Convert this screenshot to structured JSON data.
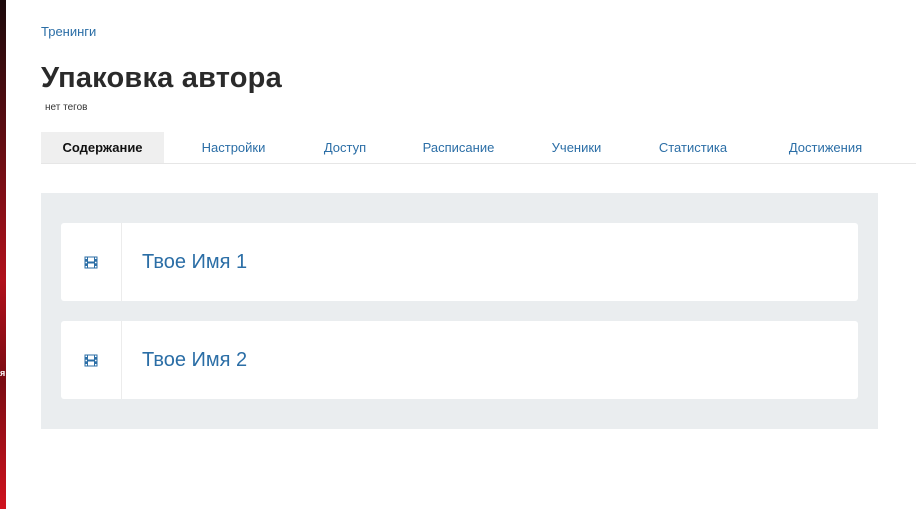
{
  "breadcrumb": {
    "label": "Тренинги"
  },
  "header": {
    "title": "Упаковка автора",
    "tags": "нет тегов"
  },
  "tabs": [
    {
      "label": "Содержание",
      "active": true
    },
    {
      "label": "Настройки",
      "active": false
    },
    {
      "label": "Доступ",
      "active": false
    },
    {
      "label": "Расписание",
      "active": false
    },
    {
      "label": "Ученики",
      "active": false
    },
    {
      "label": "Статистика",
      "active": false
    },
    {
      "label": "Достижения",
      "active": false
    }
  ],
  "lessons": [
    {
      "title": "Твое Имя 1",
      "icon": "film-icon"
    },
    {
      "title": "Твое Имя 2",
      "icon": "film-icon"
    }
  ],
  "sidebar_strip": {
    "letter": "я"
  },
  "colors": {
    "link": "#2b6ea6",
    "active_tab_bg": "#efefef",
    "panel_bg": "#eaedef",
    "title_text": "#2a2a2a"
  }
}
